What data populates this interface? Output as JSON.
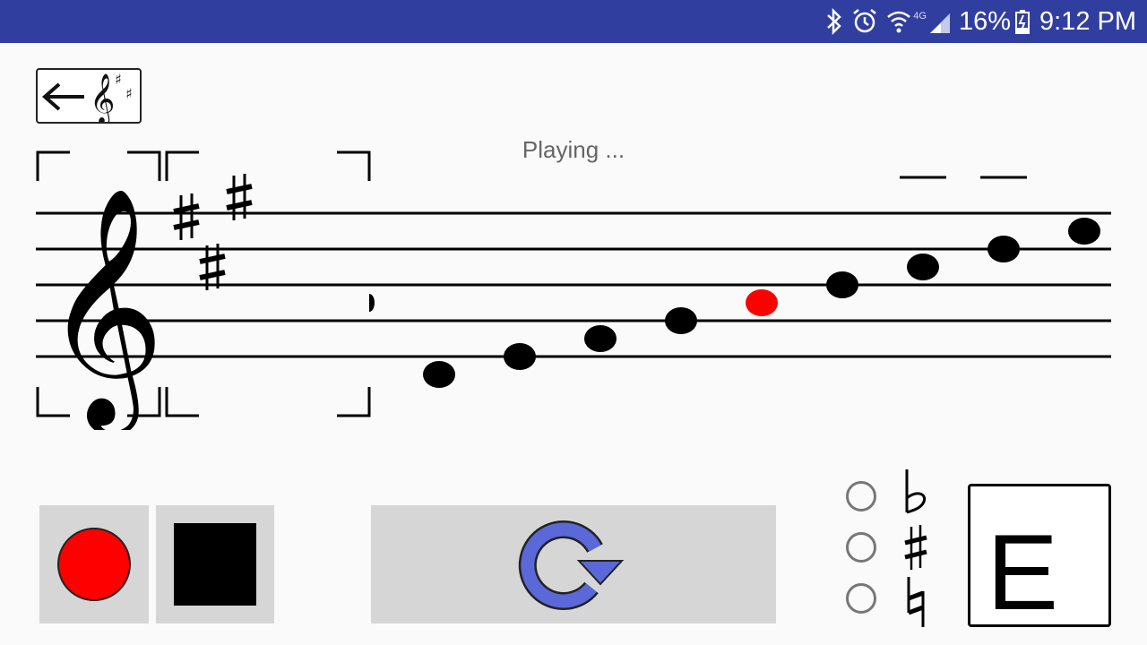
{
  "status_bar": {
    "battery": "16%",
    "time": "9:12 PM",
    "network": "4G",
    "icons": [
      "bluetooth-icon",
      "alarm-icon",
      "wifi-icon",
      "signal-icon",
      "battery-icon"
    ]
  },
  "header": {
    "back_icon": "back-arrow-key-signature-icon"
  },
  "status_message": "Playing ...",
  "staff": {
    "clef": "treble",
    "key_signature": [
      "F#",
      "C#",
      "G#"
    ],
    "notes": [
      {
        "pitch": "D4",
        "highlighted": false
      },
      {
        "pitch": "E4",
        "highlighted": false
      },
      {
        "pitch": "F#4",
        "highlighted": false
      },
      {
        "pitch": "G#4",
        "highlighted": false
      },
      {
        "pitch": "A4",
        "highlighted": true
      },
      {
        "pitch": "B4",
        "highlighted": false
      },
      {
        "pitch": "C#5",
        "highlighted": false
      },
      {
        "pitch": "D5",
        "highlighted": false
      },
      {
        "pitch": "E5",
        "highlighted": false
      }
    ]
  },
  "controls": {
    "record_icon": "record-icon",
    "stop_icon": "stop-icon",
    "replay_icon": "replay-icon"
  },
  "accidentals": [
    {
      "name": "flat",
      "glyph": "♭",
      "selected": false
    },
    {
      "name": "sharp",
      "glyph": "♯",
      "selected": false
    },
    {
      "name": "natural",
      "glyph": "♮",
      "selected": false
    }
  ],
  "answer": {
    "letter": "E"
  },
  "colors": {
    "status_bar": "#303f9f",
    "highlight_note": "#ff0000",
    "record": "#ff0000",
    "replay": "#5a68d8",
    "button_bg": "#d6d6d6"
  }
}
